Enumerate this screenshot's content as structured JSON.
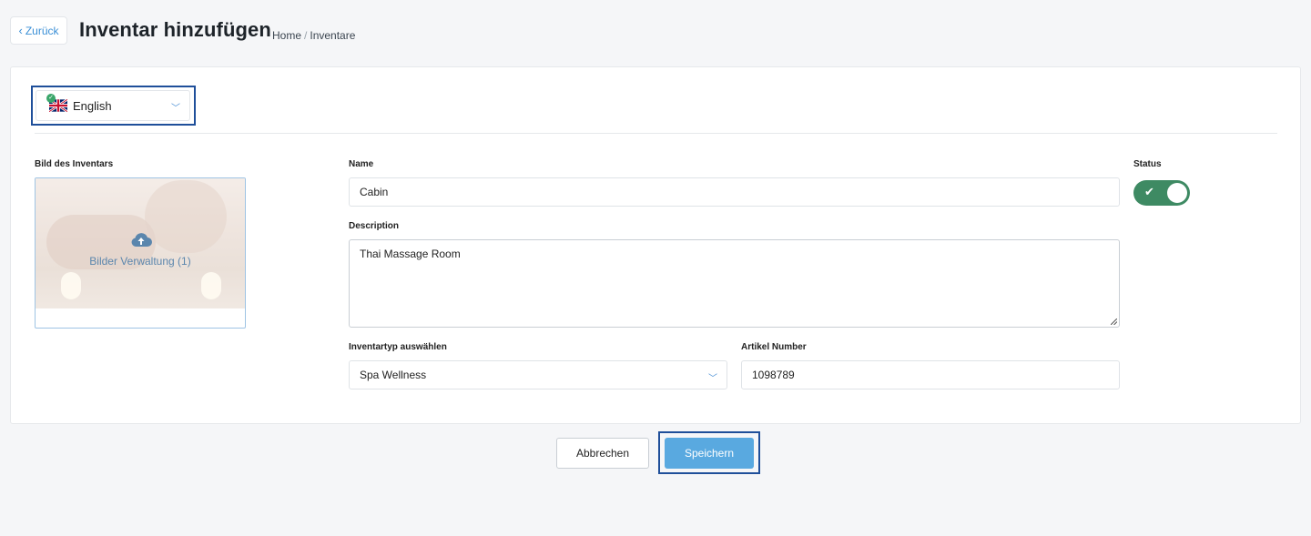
{
  "header": {
    "back_label": "Zurück",
    "title": "Inventar hinzufügen",
    "breadcrumb": [
      "Home",
      "Inventare"
    ]
  },
  "language": {
    "selected": "English",
    "flag": "uk-flag-icon"
  },
  "image": {
    "label": "Bild des Inventars",
    "caption": "Bilder Verwaltung (1)",
    "icon": "cloud-upload-icon"
  },
  "form": {
    "name_label": "Name",
    "name_value": "Cabin",
    "description_label": "Description",
    "description_value": "Thai Massage Room",
    "type_label": "Inventartyp auswählen",
    "type_value": "Spa Wellness",
    "article_label": "Artikel Number",
    "article_value": "1098789",
    "status_label": "Status",
    "status_on": true
  },
  "actions": {
    "cancel_label": "Abbrechen",
    "save_label": "Speichern"
  },
  "colors": {
    "accent": "#59a9e0",
    "toggle_on": "#3e8a63",
    "highlight_frame": "#1f4f9a"
  }
}
